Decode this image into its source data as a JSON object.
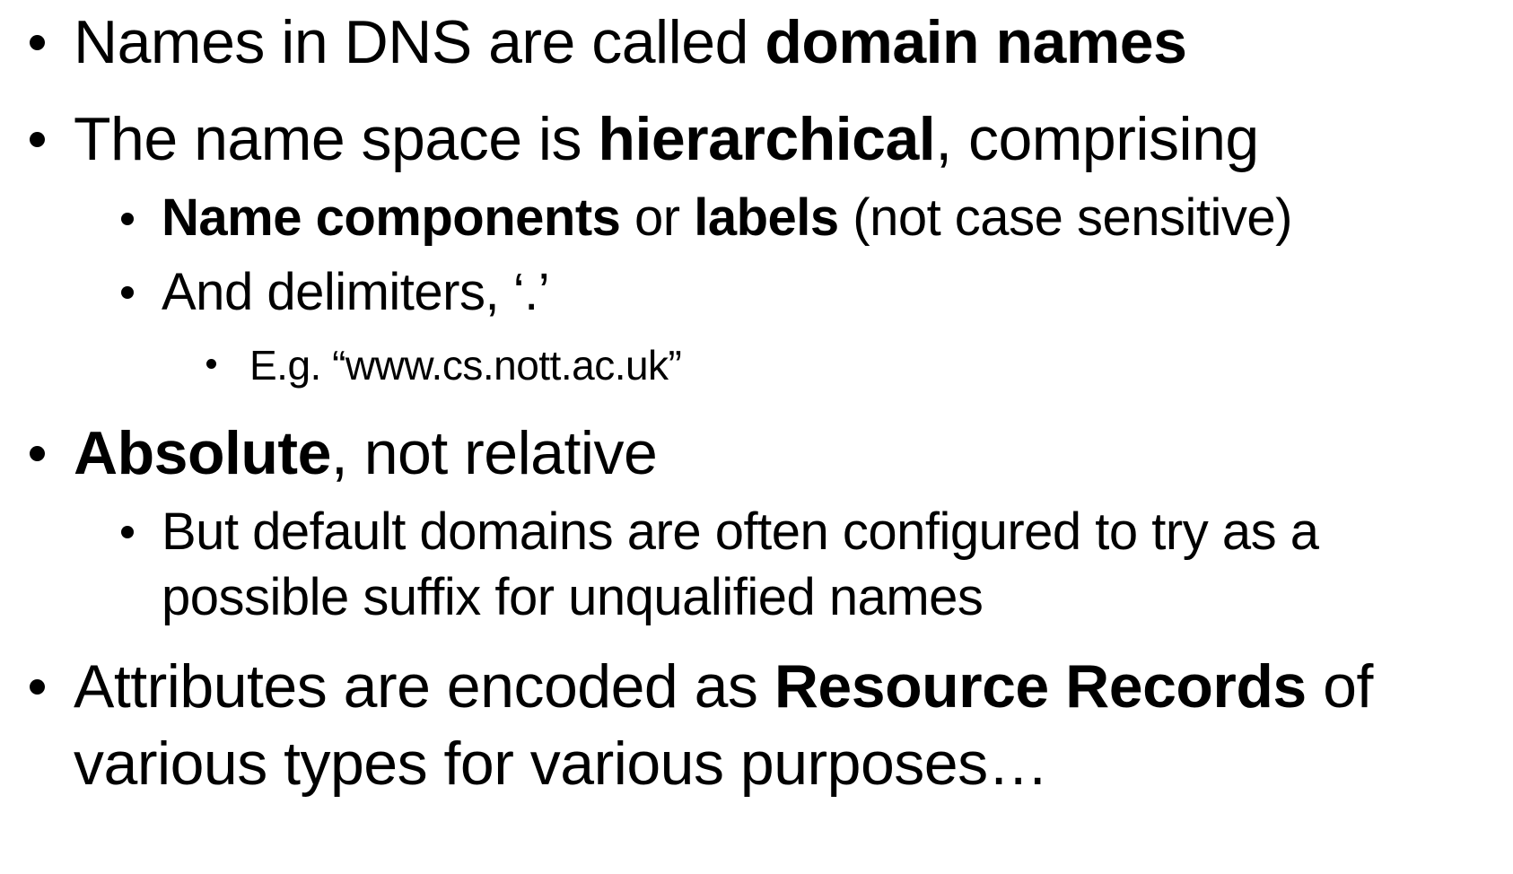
{
  "bullets": [
    {
      "level": 1,
      "lines": [
        [
          {
            "text": "Names in DNS are called "
          },
          {
            "text": "domain names",
            "bold": true
          }
        ]
      ]
    },
    {
      "level": 1,
      "lines": [
        [
          {
            "text": "The name space is "
          },
          {
            "text": "hierarchical",
            "bold": true
          },
          {
            "text": ", comprising"
          }
        ]
      ]
    },
    {
      "level": 2,
      "lines": [
        [
          {
            "text": "Name components",
            "bold": true
          },
          {
            "text": " or "
          },
          {
            "text": "labels",
            "bold": true
          },
          {
            "text": " (not case sensitive)"
          }
        ]
      ]
    },
    {
      "level": 2,
      "lines": [
        [
          {
            "text": "And delimiters, ‘.’"
          }
        ]
      ]
    },
    {
      "level": 3,
      "lines": [
        [
          {
            "text": "E.g. “www.cs.nott.ac.uk”"
          }
        ]
      ]
    },
    {
      "level": 1,
      "lines": [
        [
          {
            "text": "Absolute",
            "bold": true
          },
          {
            "text": ", not relative"
          }
        ]
      ]
    },
    {
      "level": 2,
      "lines": [
        [
          {
            "text": "But default domains are often configured to try as a"
          }
        ],
        [
          {
            "text": "possible suffix for unqualified names"
          }
        ]
      ]
    },
    {
      "level": 1,
      "lines": [
        [
          {
            "text": "Attributes are encoded as "
          },
          {
            "text": "Resource Records",
            "bold": true
          },
          {
            "text": " of"
          }
        ],
        [
          {
            "text": "various types for various purposes…"
          }
        ]
      ]
    }
  ]
}
